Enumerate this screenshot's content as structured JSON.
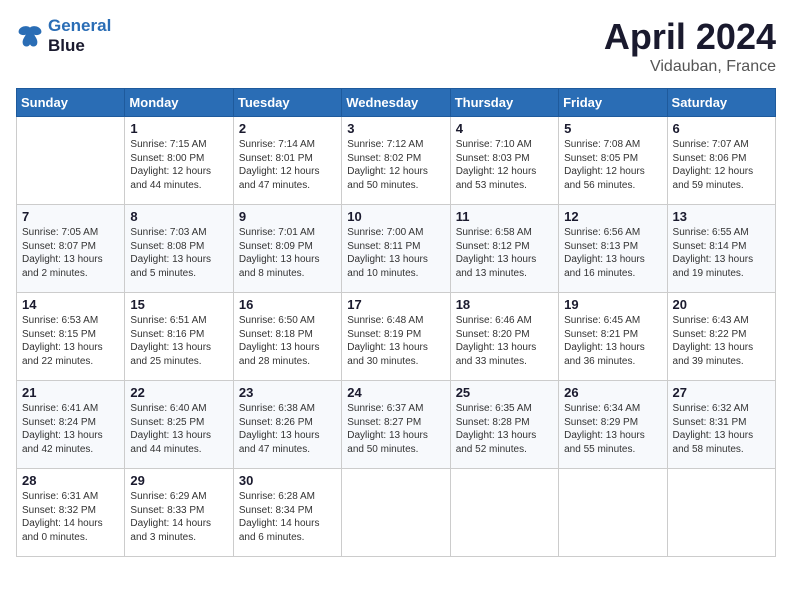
{
  "header": {
    "logo_line1": "General",
    "logo_line2": "Blue",
    "title": "April 2024",
    "subtitle": "Vidauban, France"
  },
  "days_of_week": [
    "Sunday",
    "Monday",
    "Tuesday",
    "Wednesday",
    "Thursday",
    "Friday",
    "Saturday"
  ],
  "weeks": [
    [
      {
        "day": null
      },
      {
        "day": "1",
        "sunrise": "7:15 AM",
        "sunset": "8:00 PM",
        "daylight": "12 hours and 44 minutes."
      },
      {
        "day": "2",
        "sunrise": "7:14 AM",
        "sunset": "8:01 PM",
        "daylight": "12 hours and 47 minutes."
      },
      {
        "day": "3",
        "sunrise": "7:12 AM",
        "sunset": "8:02 PM",
        "daylight": "12 hours and 50 minutes."
      },
      {
        "day": "4",
        "sunrise": "7:10 AM",
        "sunset": "8:03 PM",
        "daylight": "12 hours and 53 minutes."
      },
      {
        "day": "5",
        "sunrise": "7:08 AM",
        "sunset": "8:05 PM",
        "daylight": "12 hours and 56 minutes."
      },
      {
        "day": "6",
        "sunrise": "7:07 AM",
        "sunset": "8:06 PM",
        "daylight": "12 hours and 59 minutes."
      }
    ],
    [
      {
        "day": "7",
        "sunrise": "7:05 AM",
        "sunset": "8:07 PM",
        "daylight": "13 hours and 2 minutes."
      },
      {
        "day": "8",
        "sunrise": "7:03 AM",
        "sunset": "8:08 PM",
        "daylight": "13 hours and 5 minutes."
      },
      {
        "day": "9",
        "sunrise": "7:01 AM",
        "sunset": "8:09 PM",
        "daylight": "13 hours and 8 minutes."
      },
      {
        "day": "10",
        "sunrise": "7:00 AM",
        "sunset": "8:11 PM",
        "daylight": "13 hours and 10 minutes."
      },
      {
        "day": "11",
        "sunrise": "6:58 AM",
        "sunset": "8:12 PM",
        "daylight": "13 hours and 13 minutes."
      },
      {
        "day": "12",
        "sunrise": "6:56 AM",
        "sunset": "8:13 PM",
        "daylight": "13 hours and 16 minutes."
      },
      {
        "day": "13",
        "sunrise": "6:55 AM",
        "sunset": "8:14 PM",
        "daylight": "13 hours and 19 minutes."
      }
    ],
    [
      {
        "day": "14",
        "sunrise": "6:53 AM",
        "sunset": "8:15 PM",
        "daylight": "13 hours and 22 minutes."
      },
      {
        "day": "15",
        "sunrise": "6:51 AM",
        "sunset": "8:16 PM",
        "daylight": "13 hours and 25 minutes."
      },
      {
        "day": "16",
        "sunrise": "6:50 AM",
        "sunset": "8:18 PM",
        "daylight": "13 hours and 28 minutes."
      },
      {
        "day": "17",
        "sunrise": "6:48 AM",
        "sunset": "8:19 PM",
        "daylight": "13 hours and 30 minutes."
      },
      {
        "day": "18",
        "sunrise": "6:46 AM",
        "sunset": "8:20 PM",
        "daylight": "13 hours and 33 minutes."
      },
      {
        "day": "19",
        "sunrise": "6:45 AM",
        "sunset": "8:21 PM",
        "daylight": "13 hours and 36 minutes."
      },
      {
        "day": "20",
        "sunrise": "6:43 AM",
        "sunset": "8:22 PM",
        "daylight": "13 hours and 39 minutes."
      }
    ],
    [
      {
        "day": "21",
        "sunrise": "6:41 AM",
        "sunset": "8:24 PM",
        "daylight": "13 hours and 42 minutes."
      },
      {
        "day": "22",
        "sunrise": "6:40 AM",
        "sunset": "8:25 PM",
        "daylight": "13 hours and 44 minutes."
      },
      {
        "day": "23",
        "sunrise": "6:38 AM",
        "sunset": "8:26 PM",
        "daylight": "13 hours and 47 minutes."
      },
      {
        "day": "24",
        "sunrise": "6:37 AM",
        "sunset": "8:27 PM",
        "daylight": "13 hours and 50 minutes."
      },
      {
        "day": "25",
        "sunrise": "6:35 AM",
        "sunset": "8:28 PM",
        "daylight": "13 hours and 52 minutes."
      },
      {
        "day": "26",
        "sunrise": "6:34 AM",
        "sunset": "8:29 PM",
        "daylight": "13 hours and 55 minutes."
      },
      {
        "day": "27",
        "sunrise": "6:32 AM",
        "sunset": "8:31 PM",
        "daylight": "13 hours and 58 minutes."
      }
    ],
    [
      {
        "day": "28",
        "sunrise": "6:31 AM",
        "sunset": "8:32 PM",
        "daylight": "14 hours and 0 minutes."
      },
      {
        "day": "29",
        "sunrise": "6:29 AM",
        "sunset": "8:33 PM",
        "daylight": "14 hours and 3 minutes."
      },
      {
        "day": "30",
        "sunrise": "6:28 AM",
        "sunset": "8:34 PM",
        "daylight": "14 hours and 6 minutes."
      },
      {
        "day": null
      },
      {
        "day": null
      },
      {
        "day": null
      },
      {
        "day": null
      }
    ]
  ]
}
